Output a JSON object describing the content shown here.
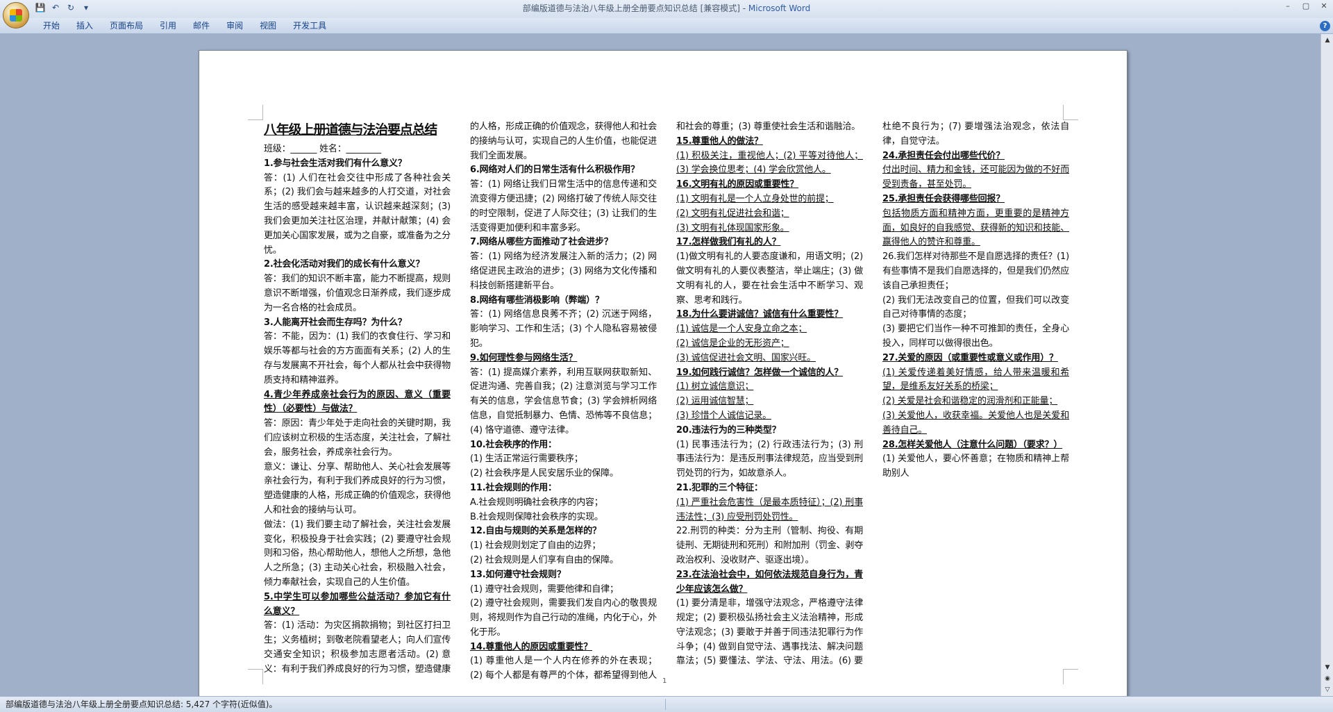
{
  "window": {
    "title": "部编版道德与法治八年级上册全册要点知识总结 [兼容模式] - ",
    "app_name": "Microsoft Word",
    "controls": [
      "–",
      "▢",
      "✕"
    ]
  },
  "qat": {
    "save": "💾",
    "undo": "↶",
    "redo": "↻",
    "customize": "▾"
  },
  "ribbon": {
    "tabs": [
      "开始",
      "插入",
      "页面布局",
      "引用",
      "邮件",
      "审阅",
      "视图",
      "开发工具"
    ],
    "help": "?"
  },
  "doc": {
    "title": "八年级上册道德与法治要点总结",
    "info": "班级：______ 姓名：________",
    "page_number": "1",
    "paras": [
      {
        "t": "1.参与社会生活对我们有什么意义？",
        "c": "q"
      },
      {
        "t": "答：(1) 人们在社会交往中形成了各种社会关系；(2) 我们会与越来越多的人打交道，对社会生活的感受越来越丰富，认识越来越深刻；(3) 我们会更加关注社区治理，并献计献策；(4) 会更加关心国家发展，或为之自豪，或准备为之分忧。",
        "c": ""
      },
      {
        "t": "2.社会化活动对我们的成长有什么意义？",
        "c": "q"
      },
      {
        "t": "答：我们的知识不断丰富，能力不断提高，规则意识不断增强，价值观念日渐养成，我们逐步成为一名合格的社会成员。",
        "c": ""
      },
      {
        "t": "3.人能离开社会而生存吗？为什么？",
        "c": "q"
      },
      {
        "t": "答：不能，因为：(1) 我们的衣食住行、学习和娱乐等都与社会的方方面面有关系；(2) 人的生存与发展离不开社会，每个人都从社会中获得物质支持和精神滋养。",
        "c": ""
      },
      {
        "t": "4.青少年养成亲社会行为的原因、意义（重要性）（必要性）与做法？",
        "c": "bu"
      },
      {
        "t": "答：原因：青少年处于走向社会的关键时期，我们应该树立积极的生活态度，关注社会，了解社会，服务社会，养成亲社会行为。",
        "c": ""
      },
      {
        "t": "意义：谦让、分享、帮助他人、关心社会发展等亲社会行为，有利于我们养成良好的行为习惯，塑造健康的人格，形成正确的价值观念，获得他人和社会的接纳与认可。",
        "c": ""
      },
      {
        "t": "做法：(1) 我们要主动了解社会，关注社会发展变化，积极投身于社会实践；(2) 要遵守社会规则和习俗，热心帮助他人，想他人之所想，急他人之所急；(3) 主动关心社会，积极融入社会，倾力奉献社会，实现自己的人生价值。",
        "c": ""
      },
      {
        "t": "5.中学生可以参加哪些公益活动？参加它有什么意义？",
        "c": "bu"
      },
      {
        "t": "答：(1) 活动：为灾区捐款捐物；到社区打扫卫生；义务植树；到敬老院看望老人；向人们宣传交通安全知识；积极参加志愿者活动。(2) 意义：有利于我们养成良好的行为习惯，塑造健康的人格，形成正确的价值观念，获得他人和社会的接纳与认可，实现自己的人生价值，也能促进我们全面发展。",
        "c": ""
      },
      {
        "t": "6.网络对人们的日常生活有什么积极作用？",
        "c": "q"
      },
      {
        "t": "答：(1) 网络让我们日常生活中的信息传递和交流变得方便迅捷；(2) 网络打破了传统人际交往的时空限制，促进了人际交往；(3) 让我们的生活变得更加便利和丰富多彩。",
        "c": ""
      },
      {
        "t": "7.网络从哪些方面推动了社会进步？",
        "c": "q"
      },
      {
        "t": "答：(1) 网络为经济发展注入新的活力；(2) 网络促进民主政治的进步；(3) 网络为文化传播和科技创新搭建新平台。",
        "c": ""
      },
      {
        "t": "8.网络有哪些消极影响（弊端）？",
        "c": "q"
      },
      {
        "t": "答：(1) 网络信息良莠不齐；(2) 沉迷于网络，影响学习、工作和生活；(3) 个人隐私容易被侵犯。",
        "c": ""
      },
      {
        "t": "9.如何理性参与网络生活？",
        "c": "bu"
      },
      {
        "t": "答：(1) 提高媒介素养，利用互联网获取新知、促进沟通、完善自我；(2) 注意浏览与学习工作有关的信息，学会信息节食；(3) 学会辨析网络信息，自觉抵制暴力、色情、恐怖等不良信息；(4) 恪守道德、遵守法律。",
        "c": ""
      },
      {
        "t": "10.社会秩序的作用：",
        "c": "q"
      },
      {
        "t": "(1) 生活正常运行需要秩序；",
        "c": ""
      },
      {
        "t": "(2) 社会秩序是人民安居乐业的保障。",
        "c": ""
      },
      {
        "t": "11.社会规则的作用：",
        "c": "q"
      },
      {
        "t": "A.社会规则明确社会秩序的内容；",
        "c": ""
      },
      {
        "t": "B.社会规则保障社会秩序的实现。",
        "c": ""
      },
      {
        "t": "12.自由与规则的关系是怎样的？",
        "c": "q"
      },
      {
        "t": "(1) 社会规则划定了自由的边界；",
        "c": ""
      },
      {
        "t": "(2) 社会规则是人们享有自由的保障。",
        "c": ""
      },
      {
        "t": "13.如何遵守社会规则？",
        "c": "q"
      },
      {
        "t": "(1) 遵守社会规则，需要他律和自律；",
        "c": ""
      },
      {
        "t": "(2) 遵守社会规则，需要我们发自内心的敬畏规则，将规则作为自己行动的准绳，内化于心，外化于形。",
        "c": ""
      },
      {
        "t": "14.尊重他人的原因或重要性？",
        "c": "bu"
      },
      {
        "t": "(1) 尊重他人是一个人内在修养的外在表现；(2) 每个人都是有尊严的个体，都希望得到他人和社会的尊重；(3) 尊重使社会生活和谐融洽。",
        "c": ""
      },
      {
        "t": "15.尊重他人的做法？",
        "c": "bu"
      },
      {
        "t": "(1) 积极关注，重视他人；(2) 平等对待他人；(3) 学会换位思考；(4) 学会欣赏他人。",
        "c": "u"
      },
      {
        "t": "16.文明有礼的原因或重要性？",
        "c": "bu"
      },
      {
        "t": "(1) 文明有礼是一个人立身处世的前提；",
        "c": "u"
      },
      {
        "t": "(2) 文明有礼促进社会和谐；",
        "c": "u"
      },
      {
        "t": "(3) 文明有礼体现国家形象。",
        "c": "u"
      },
      {
        "t": "17.怎样做我们有礼的人？",
        "c": "bu"
      },
      {
        "t": "(1)做文明有礼的人要态度谦和，用语文明；(2)做文明有礼的人要仪表整洁，举止端庄；(3) 做文明有礼的人，要在社会生活中不断学习、观察、思考和践行。",
        "c": ""
      },
      {
        "t": "18.为什么要讲诚信？诚信有什么重要性？",
        "c": "bu"
      },
      {
        "t": "(1) 诚信是一个人安身立命之本；",
        "c": "u"
      },
      {
        "t": "(2) 诚信是企业的无形资产；",
        "c": "u"
      },
      {
        "t": "(3) 诚信促进社会文明、国家兴旺。",
        "c": "u"
      },
      {
        "t": "19.如何践行诚信？怎样做一个诚信的人？",
        "c": "bu"
      },
      {
        "t": "(1) 树立诚信意识；",
        "c": "u"
      },
      {
        "t": "(2) 运用诚信智慧；",
        "c": "u"
      },
      {
        "t": "(3) 珍惜个人诚信记录。",
        "c": "u"
      },
      {
        "t": "20.违法行为的三种类型？",
        "c": "q"
      },
      {
        "t": "(1) 民事违法行为；(2) 行政违法行为；(3) 刑事违法行为：是违反刑事法律规范，应当受到刑罚处罚的行为，如故意杀人。",
        "c": ""
      },
      {
        "t": "21.犯罪的三个特征：",
        "c": "q"
      },
      {
        "t": "(1) 严重社会危害性（是最本质特征）；(2) 刑事违法性；(3) 应受刑罚处罚性。",
        "c": "u"
      },
      {
        "t": "22.刑罚的种类：分为主刑（管制、拘役、有期徒刑、无期徒刑和死刑）和附加刑（罚金、剥夺政治权利、没收财产、驱逐出境）。",
        "c": ""
      },
      {
        "t": "23.在法治社会中，如何依法规范自身行为，青少年应该怎么做？",
        "c": "bu"
      },
      {
        "t": "(1) 要分清是非，增强守法观念，严格遵守法律规定；(2) 要积极弘扬社会主义法治精神，形成守法观念；(3) 要敢于并善于同违法犯罪行为作斗争；(4) 做到自觉守法、遇事找法、解决问题靠法；(5) 要懂法、学法、守法、用法。(6) 要杜绝不良行为；(7) 要增强法治观念，依法自律，自觉守法。",
        "c": ""
      },
      {
        "t": "24.承担责任会付出哪些代价？",
        "c": "bu"
      },
      {
        "t": "付出时间、精力和金钱，还可能因为做的不好而受到责备，甚至处罚。",
        "c": "u"
      },
      {
        "t": "25.承担责任会获得哪些回报？",
        "c": "bu"
      },
      {
        "t": "包括物质方面和精神方面，更重要的是精神方面，如良好的自我感觉、获得新的知识和技能、赢得他人的赞许和尊重。",
        "c": "u"
      },
      {
        "t": "26.我们怎样对待那些不是自愿选择的责任？(1) 有些事情不是我们自愿选择的，但是我们仍然应该自己承担责任；",
        "c": ""
      },
      {
        "t": "(2) 我们无法改变自己的位置，但我们可以改变自己对待事情的态度；",
        "c": ""
      },
      {
        "t": "(3) 要把它们当作一种不可推卸的责任，全身心投入，同样可以做得很出色。",
        "c": ""
      },
      {
        "t": "27.关爱的原因（或重要性或意义或作用）？",
        "c": "bu"
      },
      {
        "t": "(1) 关爱传递着美好情感，给人带来温暖和希望，是维系友好关系的桥梁；",
        "c": "u"
      },
      {
        "t": "(2) 关爱是社会和谐稳定的润滑剂和正能量；",
        "c": "u"
      },
      {
        "t": "(3) 关爱他人，收获幸福。关爱他人也是关爱和善待自己。",
        "c": "u"
      },
      {
        "t": "28.怎样关爱他人（注意什么问题）（要求？）",
        "c": "bu"
      },
      {
        "t": "(1) 关爱他人，要心怀善意；在物质和精神上帮助别人",
        "c": ""
      }
    ]
  },
  "status": {
    "text": "部编版道德与法治八年级上册全册要点知识总结: 5,427 个字符(近似值)。"
  },
  "scrollbar": {
    "up": "▲",
    "down": "▼",
    "prev": "◉",
    "next": "▽"
  }
}
